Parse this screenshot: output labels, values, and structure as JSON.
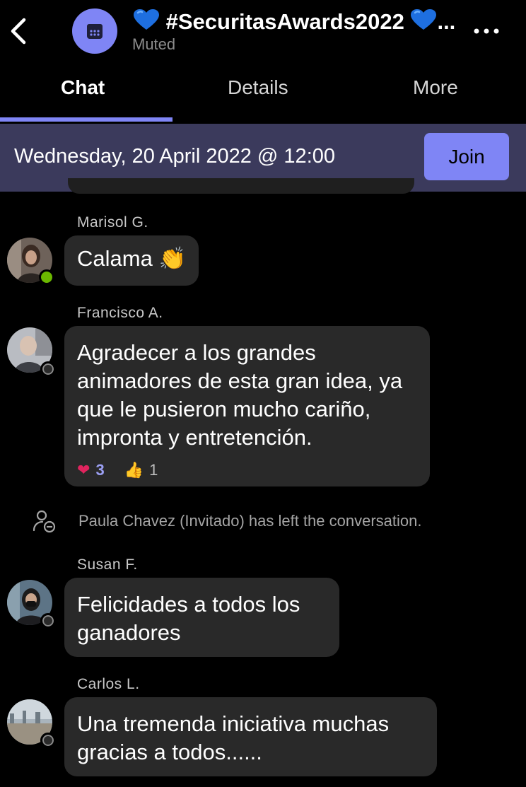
{
  "header": {
    "title": "#SecuritasAwards2022",
    "ellipsis": "...",
    "subtitle": "Muted"
  },
  "tabs": [
    {
      "label": "Chat"
    },
    {
      "label": "Details"
    },
    {
      "label": "More"
    }
  ],
  "banner": {
    "date": "Wednesday, 20 April 2022 @ 12:00",
    "join_label": "Join"
  },
  "messages": [
    {
      "sender": "Marisol G.",
      "text": "Calama",
      "emoji": "👏",
      "status": "online"
    },
    {
      "sender": "Francisco A.",
      "text": "Agradecer a los grandes animadores de esta gran idea, ya que le pusieron mucho cariño, impronta y entretención.",
      "status": "away",
      "reactions": {
        "heart": "3",
        "thumbs": "1"
      }
    },
    {
      "sender": "Susan F.",
      "text": "Felicidades a todos los ganadores",
      "status": "away"
    },
    {
      "sender": "Carlos L.",
      "text": "Una tremenda iniciativa muchas gracias a todos......",
      "status": "away"
    }
  ],
  "system_event": {
    "text": "Paula Chavez (Invitado) has left the conversation."
  },
  "colors": {
    "accent": "#7f85f5",
    "banner_bg": "#3b3a5c",
    "bubble_bg": "#292929",
    "heart": "#e0245e",
    "online": "#6bb700"
  }
}
